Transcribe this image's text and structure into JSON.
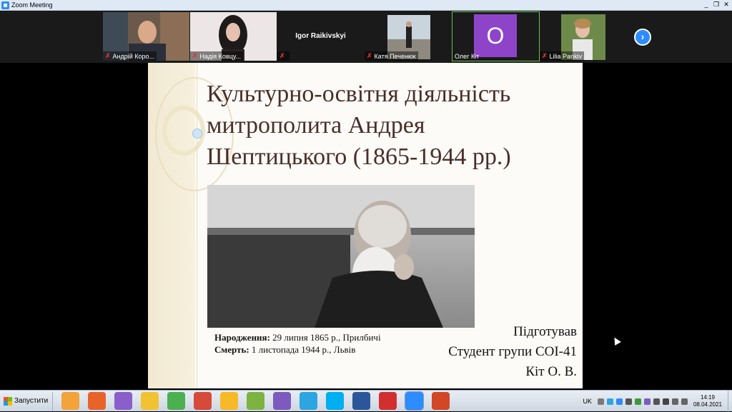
{
  "window": {
    "title": "Zoom Meeting",
    "min": "_",
    "restore": "❐",
    "close": "✕"
  },
  "participants": [
    {
      "name": "Андрій Коро...",
      "muted": true,
      "video": "man-office"
    },
    {
      "name": "Надія Ковцу...",
      "muted": true,
      "video": "woman-dark-hair"
    },
    {
      "name": "",
      "display_name": "Igor Raikivskyi",
      "muted": true,
      "video": "none"
    },
    {
      "name": "Катя Печенюк",
      "muted": true,
      "video": "street"
    },
    {
      "name": "Олег Кіт",
      "muted": false,
      "video": "avatar",
      "avatar_letter": "O",
      "active": true
    },
    {
      "name": "Lilia Pankiv",
      "muted": true,
      "video": "woman-light"
    }
  ],
  "slide": {
    "title_lines": [
      "Культурно-освітня діяльність",
      "митрополита Андрея",
      "Шептицького (1865-1944 рр.)"
    ],
    "birth_label": "Народження:",
    "birth_text": " 29 липня 1865 р., Прилбичі",
    "death_label": "Смерть:",
    "death_text": " 1 листопада 1944 р., Львів",
    "author_lines": [
      "Підготував",
      "Студент групи СОІ-41",
      "Кіт О. В."
    ]
  },
  "taskbar": {
    "start_label": "Запустити",
    "apps": [
      {
        "icon": "media-player-icon",
        "color": "#f2a33a"
      },
      {
        "icon": "firefox-icon",
        "color": "#e8632a"
      },
      {
        "icon": "visual-studio-icon",
        "color": "#8a5fc9"
      },
      {
        "icon": "archicad-icon",
        "color": "#f1c232"
      },
      {
        "icon": "chrome-icon",
        "color": "#4caf50"
      },
      {
        "icon": "chrome-alt-icon",
        "color": "#d64a3a"
      },
      {
        "icon": "yandex-icon",
        "color": "#f7b928"
      },
      {
        "icon": "file-manager-icon",
        "color": "#7cb342"
      },
      {
        "icon": "viber-icon",
        "color": "#7d5bbe"
      },
      {
        "icon": "telegram-icon",
        "color": "#2ca5e0"
      },
      {
        "icon": "skype-icon",
        "color": "#00aff0"
      },
      {
        "icon": "word-icon",
        "color": "#2b579a"
      },
      {
        "icon": "acrobat-icon",
        "color": "#d32f2f"
      },
      {
        "icon": "zoom-icon",
        "color": "#2d8cff",
        "active": true
      },
      {
        "icon": "powerpoint-icon",
        "color": "#d24726"
      }
    ],
    "lang": "UK",
    "time": "14:19",
    "date": "08.04.2021"
  },
  "colors": {
    "zoom_blue": "#2d8cff",
    "muted_red": "#e0312b",
    "slide_title": "#4a2e2a"
  }
}
